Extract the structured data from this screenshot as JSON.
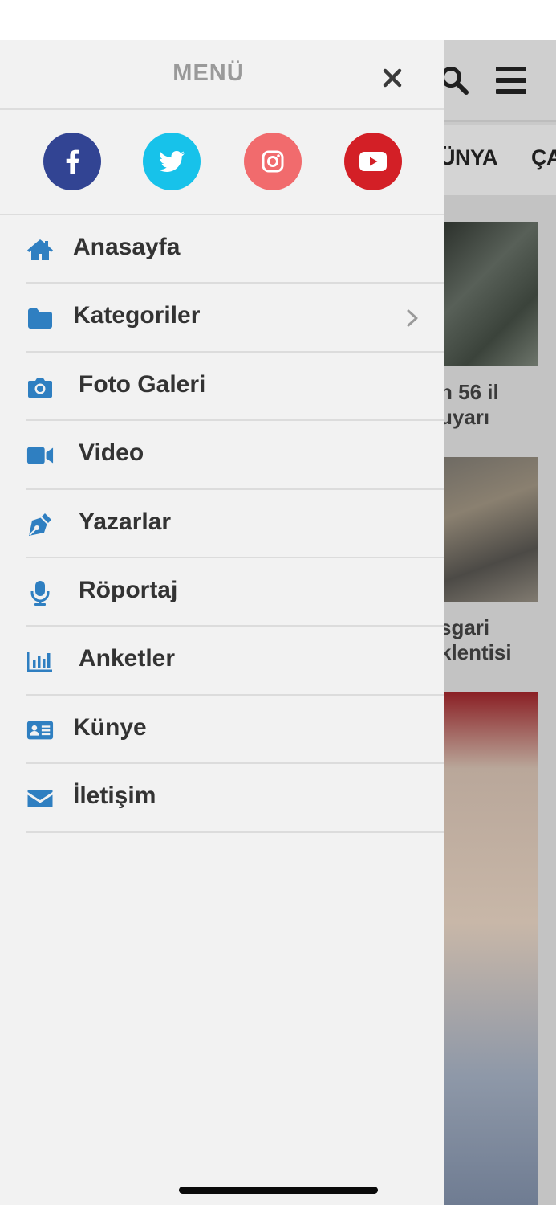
{
  "background_page": {
    "nav_items": [
      "ÜNYA",
      "ÇA"
    ],
    "headlines": [
      [
        "n 56 il",
        "uyarı"
      ],
      [
        "sgari",
        "klentisi"
      ]
    ]
  },
  "drawer": {
    "title": "MENÜ",
    "social": [
      "facebook-icon",
      "twitter-icon",
      "instagram-icon",
      "youtube-icon"
    ],
    "items": [
      {
        "label": "Anasayfa",
        "icon": "home-icon"
      },
      {
        "label": "Kategoriler",
        "icon": "folder-icon",
        "has_submenu": true
      },
      {
        "label": "Foto Galeri",
        "icon": "camera-icon"
      },
      {
        "label": "Video",
        "icon": "video-camera-icon"
      },
      {
        "label": "Yazarlar",
        "icon": "pen-icon"
      },
      {
        "label": "Röportaj",
        "icon": "microphone-icon"
      },
      {
        "label": "Anketler",
        "icon": "bar-chart-icon"
      },
      {
        "label": "Künye",
        "icon": "id-card-icon"
      },
      {
        "label": "İletişim",
        "icon": "envelope-icon"
      }
    ]
  },
  "colors": {
    "accent": "#2f7fc1",
    "facebook": "#324493",
    "twitter": "#17c2ea",
    "instagram": "#f16b6d",
    "youtube": "#d31f26"
  }
}
